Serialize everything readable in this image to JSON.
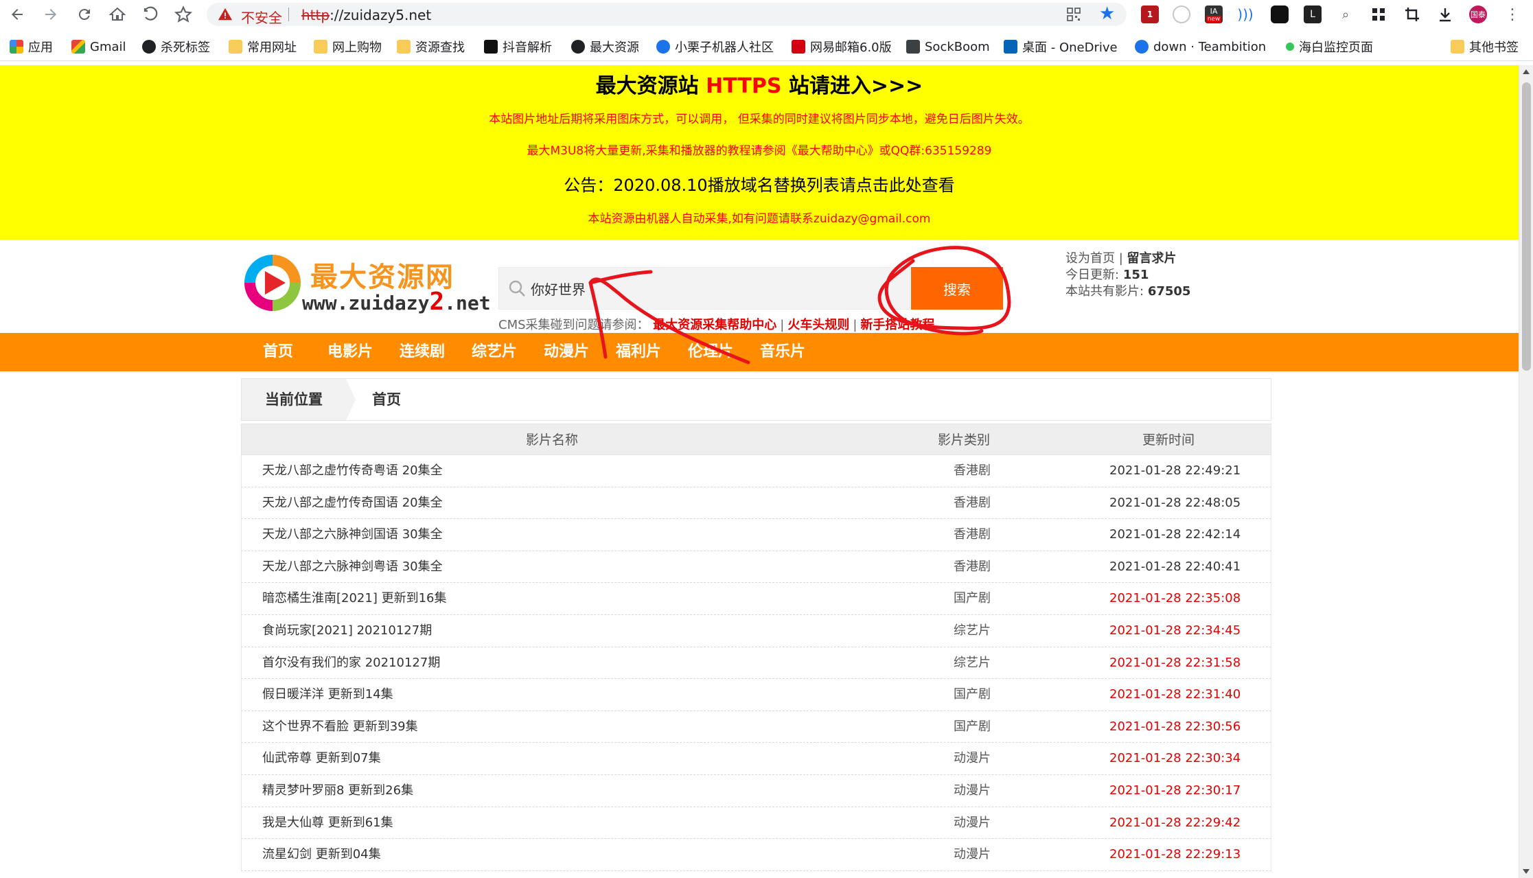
{
  "browser": {
    "security_label": "不安全",
    "url_scheme": "http",
    "url_rest": "://zuidazy5.net",
    "extension_badges": {
      "ublock": "1",
      "ia": "IA",
      "ia_badge": "new",
      "profile": "国泰"
    }
  },
  "bookmarks": [
    {
      "label": "应用",
      "icon": "apps-grid-icon"
    },
    {
      "label": "Gmail",
      "icon": "gmail-icon"
    },
    {
      "label": "杀死标签",
      "icon": "globe-icon"
    },
    {
      "label": "常用网址",
      "icon": "folder-icon"
    },
    {
      "label": "网上购物",
      "icon": "folder-icon"
    },
    {
      "label": "资源查找",
      "icon": "folder-icon"
    },
    {
      "label": "抖音解析",
      "icon": "tiktok-icon"
    },
    {
      "label": "最大资源",
      "icon": "globe-icon"
    },
    {
      "label": "小栗子机器人社区",
      "icon": "q-icon"
    },
    {
      "label": "网易邮箱6.0版",
      "icon": "netease-icon"
    },
    {
      "label": "SockBoom",
      "icon": "sockboom-icon"
    },
    {
      "label": "桌面 - OneDrive",
      "icon": "onedrive-icon"
    },
    {
      "label": "down · Teambition",
      "icon": "teambition-icon"
    },
    {
      "label": "海白监控页面",
      "icon": "status-dot-icon"
    },
    {
      "label": "其他书签",
      "icon": "folder-icon"
    }
  ],
  "notice": {
    "title_pre": "最大资源站 ",
    "title_https": "HTTPS",
    "title_post": " 站请进入>>>",
    "line1": "本站图片地址后期将采用图床方式，可以调用， 但采集的同时建议将图片同步本地，避免日后图片失效。",
    "line2": "最大M3U8将大量更新,采集和播放器的教程请参阅《最大帮助中心》或QQ群:635159289",
    "line3": "公告：2020.08.10播放域名替换列表请点击此处查看",
    "line4": "本站资源由机器人自动采集,如有问题请联系zuidazy@gmail.com"
  },
  "header": {
    "logo_title": "最大资源网",
    "logo_sub_a": "www.zuidazy",
    "logo_sub_b": "2",
    "logo_sub_c": ".net",
    "search_value": "你好世界",
    "search_button": "搜索",
    "cms_prefix": "CMS采集碰到问题请参阅：",
    "cms_links": [
      "最大资源采集帮助中心",
      "火车头规则",
      "新手搭站教程"
    ],
    "info": {
      "set_home": "设为首页",
      "guestbook": "留言求片",
      "today_label": "今日更新:",
      "today_count": "151",
      "total_label": "本站共有影片:",
      "total_count": "67505"
    }
  },
  "nav": [
    "首页",
    "电影片",
    "连续剧",
    "综艺片",
    "动漫片",
    "福利片",
    "伦理片",
    "音乐片"
  ],
  "breadcrumb": {
    "label": "当前位置",
    "current": "首页"
  },
  "table": {
    "headers": [
      "影片名称",
      "影片类别",
      "更新时间"
    ],
    "rows": [
      {
        "name": "天龙八部之虚竹传奇粤语 20集全",
        "type": "香港剧",
        "time": "2021-01-28 22:49:21",
        "hot": false
      },
      {
        "name": "天龙八部之虚竹传奇国语 20集全",
        "type": "香港剧",
        "time": "2021-01-28 22:48:05",
        "hot": false
      },
      {
        "name": "天龙八部之六脉神剑国语 30集全",
        "type": "香港剧",
        "time": "2021-01-28 22:42:14",
        "hot": false
      },
      {
        "name": "天龙八部之六脉神剑粤语 30集全",
        "type": "香港剧",
        "time": "2021-01-28 22:40:41",
        "hot": false
      },
      {
        "name": "暗恋橘生淮南[2021] 更新到16集",
        "type": "国产剧",
        "time": "2021-01-28 22:35:08",
        "hot": true
      },
      {
        "name": "食尚玩家[2021] 20210127期",
        "type": "综艺片",
        "time": "2021-01-28 22:34:45",
        "hot": true
      },
      {
        "name": "首尔没有我们的家 20210127期",
        "type": "综艺片",
        "time": "2021-01-28 22:31:58",
        "hot": true
      },
      {
        "name": "假日暖洋洋 更新到14集",
        "type": "国产剧",
        "time": "2021-01-28 22:31:40",
        "hot": true
      },
      {
        "name": "这个世界不看脸 更新到39集",
        "type": "国产剧",
        "time": "2021-01-28 22:30:56",
        "hot": true
      },
      {
        "name": "仙武帝尊 更新到07集",
        "type": "动漫片",
        "time": "2021-01-28 22:30:34",
        "hot": true
      },
      {
        "name": "精灵梦叶罗丽8 更新到26集",
        "type": "动漫片",
        "time": "2021-01-28 22:30:17",
        "hot": true
      },
      {
        "name": "我是大仙尊 更新到61集",
        "type": "动漫片",
        "time": "2021-01-28 22:29:42",
        "hot": true
      },
      {
        "name": "流星幻剑 更新到04集",
        "type": "动漫片",
        "time": "2021-01-28 22:29:13",
        "hot": true
      }
    ]
  },
  "colors": {
    "notice_bg": "#ffff00",
    "nav_bg": "#ff8c00",
    "search_button": "#ff6600",
    "hot_time": "#e60000",
    "annotation": "#e8141c"
  }
}
